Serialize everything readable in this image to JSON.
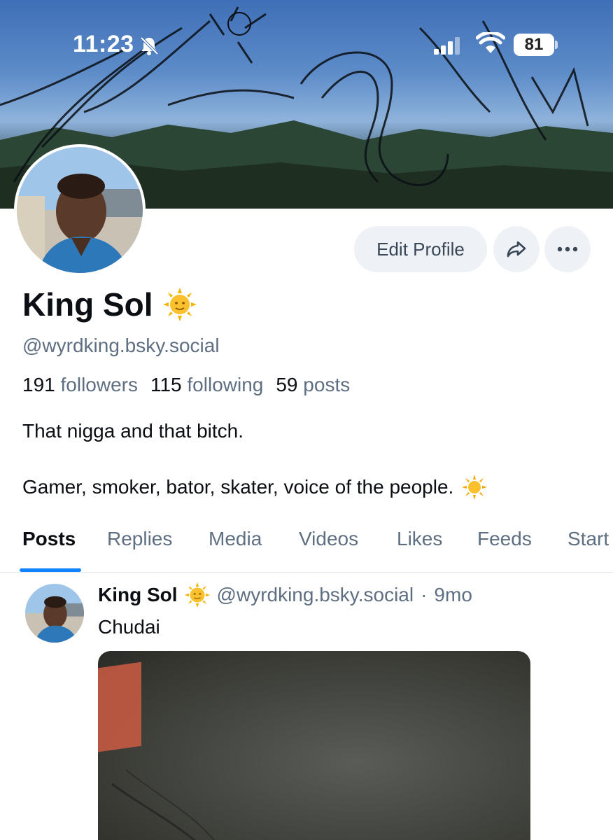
{
  "status_bar": {
    "time": "11:23",
    "battery": "81"
  },
  "profile": {
    "display_name": "King Sol",
    "handle": "@wyrdking.bsky.social",
    "stats": {
      "followers_count": "191",
      "followers_label": "followers",
      "following_count": "115",
      "following_label": "following",
      "posts_count": "59",
      "posts_label": "posts"
    },
    "bio_line1": "That nigga and that bitch.",
    "bio_line2": "Gamer, smoker, bator, skater, voice of the people."
  },
  "actions": {
    "edit_label": "Edit Profile"
  },
  "tabs": [
    {
      "label": "Posts"
    },
    {
      "label": "Replies"
    },
    {
      "label": "Media"
    },
    {
      "label": "Videos"
    },
    {
      "label": "Likes"
    },
    {
      "label": "Feeds"
    },
    {
      "label": "Start"
    }
  ],
  "post": {
    "author": "King Sol",
    "handle": "@wyrdking.bsky.social",
    "separator": "·",
    "age": "9mo",
    "text": "Chudai"
  },
  "colors": {
    "accent": "#1083fe",
    "secondary_text": "#5f6f82",
    "button_bg": "#eef2f7"
  }
}
